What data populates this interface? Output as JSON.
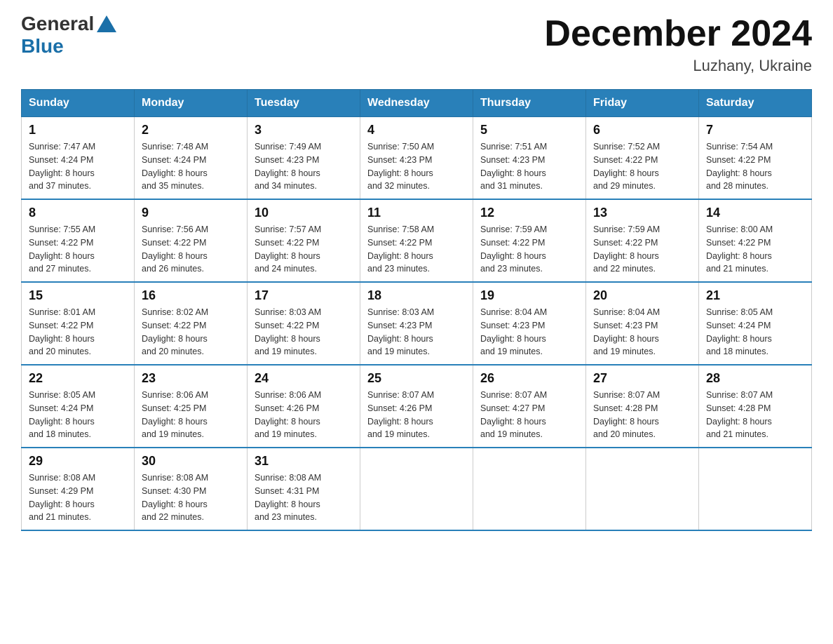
{
  "header": {
    "logo_general": "General",
    "logo_blue": "Blue",
    "month_title": "December 2024",
    "location": "Luzhany, Ukraine"
  },
  "days_of_week": [
    "Sunday",
    "Monday",
    "Tuesday",
    "Wednesday",
    "Thursday",
    "Friday",
    "Saturday"
  ],
  "weeks": [
    [
      {
        "day": "1",
        "sunrise": "7:47 AM",
        "sunset": "4:24 PM",
        "daylight": "8 hours and 37 minutes."
      },
      {
        "day": "2",
        "sunrise": "7:48 AM",
        "sunset": "4:24 PM",
        "daylight": "8 hours and 35 minutes."
      },
      {
        "day": "3",
        "sunrise": "7:49 AM",
        "sunset": "4:23 PM",
        "daylight": "8 hours and 34 minutes."
      },
      {
        "day": "4",
        "sunrise": "7:50 AM",
        "sunset": "4:23 PM",
        "daylight": "8 hours and 32 minutes."
      },
      {
        "day": "5",
        "sunrise": "7:51 AM",
        "sunset": "4:23 PM",
        "daylight": "8 hours and 31 minutes."
      },
      {
        "day": "6",
        "sunrise": "7:52 AM",
        "sunset": "4:22 PM",
        "daylight": "8 hours and 29 minutes."
      },
      {
        "day": "7",
        "sunrise": "7:54 AM",
        "sunset": "4:22 PM",
        "daylight": "8 hours and 28 minutes."
      }
    ],
    [
      {
        "day": "8",
        "sunrise": "7:55 AM",
        "sunset": "4:22 PM",
        "daylight": "8 hours and 27 minutes."
      },
      {
        "day": "9",
        "sunrise": "7:56 AM",
        "sunset": "4:22 PM",
        "daylight": "8 hours and 26 minutes."
      },
      {
        "day": "10",
        "sunrise": "7:57 AM",
        "sunset": "4:22 PM",
        "daylight": "8 hours and 24 minutes."
      },
      {
        "day": "11",
        "sunrise": "7:58 AM",
        "sunset": "4:22 PM",
        "daylight": "8 hours and 23 minutes."
      },
      {
        "day": "12",
        "sunrise": "7:59 AM",
        "sunset": "4:22 PM",
        "daylight": "8 hours and 23 minutes."
      },
      {
        "day": "13",
        "sunrise": "7:59 AM",
        "sunset": "4:22 PM",
        "daylight": "8 hours and 22 minutes."
      },
      {
        "day": "14",
        "sunrise": "8:00 AM",
        "sunset": "4:22 PM",
        "daylight": "8 hours and 21 minutes."
      }
    ],
    [
      {
        "day": "15",
        "sunrise": "8:01 AM",
        "sunset": "4:22 PM",
        "daylight": "8 hours and 20 minutes."
      },
      {
        "day": "16",
        "sunrise": "8:02 AM",
        "sunset": "4:22 PM",
        "daylight": "8 hours and 20 minutes."
      },
      {
        "day": "17",
        "sunrise": "8:03 AM",
        "sunset": "4:22 PM",
        "daylight": "8 hours and 19 minutes."
      },
      {
        "day": "18",
        "sunrise": "8:03 AM",
        "sunset": "4:23 PM",
        "daylight": "8 hours and 19 minutes."
      },
      {
        "day": "19",
        "sunrise": "8:04 AM",
        "sunset": "4:23 PM",
        "daylight": "8 hours and 19 minutes."
      },
      {
        "day": "20",
        "sunrise": "8:04 AM",
        "sunset": "4:23 PM",
        "daylight": "8 hours and 19 minutes."
      },
      {
        "day": "21",
        "sunrise": "8:05 AM",
        "sunset": "4:24 PM",
        "daylight": "8 hours and 18 minutes."
      }
    ],
    [
      {
        "day": "22",
        "sunrise": "8:05 AM",
        "sunset": "4:24 PM",
        "daylight": "8 hours and 18 minutes."
      },
      {
        "day": "23",
        "sunrise": "8:06 AM",
        "sunset": "4:25 PM",
        "daylight": "8 hours and 19 minutes."
      },
      {
        "day": "24",
        "sunrise": "8:06 AM",
        "sunset": "4:26 PM",
        "daylight": "8 hours and 19 minutes."
      },
      {
        "day": "25",
        "sunrise": "8:07 AM",
        "sunset": "4:26 PM",
        "daylight": "8 hours and 19 minutes."
      },
      {
        "day": "26",
        "sunrise": "8:07 AM",
        "sunset": "4:27 PM",
        "daylight": "8 hours and 19 minutes."
      },
      {
        "day": "27",
        "sunrise": "8:07 AM",
        "sunset": "4:28 PM",
        "daylight": "8 hours and 20 minutes."
      },
      {
        "day": "28",
        "sunrise": "8:07 AM",
        "sunset": "4:28 PM",
        "daylight": "8 hours and 21 minutes."
      }
    ],
    [
      {
        "day": "29",
        "sunrise": "8:08 AM",
        "sunset": "4:29 PM",
        "daylight": "8 hours and 21 minutes."
      },
      {
        "day": "30",
        "sunrise": "8:08 AM",
        "sunset": "4:30 PM",
        "daylight": "8 hours and 22 minutes."
      },
      {
        "day": "31",
        "sunrise": "8:08 AM",
        "sunset": "4:31 PM",
        "daylight": "8 hours and 23 minutes."
      },
      null,
      null,
      null,
      null
    ]
  ],
  "labels": {
    "sunrise": "Sunrise:",
    "sunset": "Sunset:",
    "daylight": "Daylight:"
  }
}
